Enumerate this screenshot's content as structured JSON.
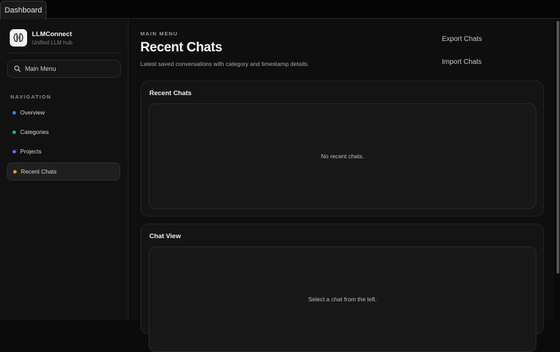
{
  "window": {
    "tab_label": "Dashboard"
  },
  "sidebar": {
    "brand": {
      "name": "LLMConnect",
      "subtitle": "Unified LLM hub"
    },
    "search": {
      "label": "Main Menu",
      "icon": "search-icon"
    },
    "nav_heading": "NAVIGATION",
    "items": [
      {
        "label": "Overview",
        "dot_color": "#3b82f6",
        "active": false
      },
      {
        "label": "Categories",
        "dot_color": "#14b8a6",
        "active": false
      },
      {
        "label": "Projects",
        "dot_color": "#8b5cf6",
        "active": false
      },
      {
        "label": "Recent Chats",
        "dot_color": "#f59e0b",
        "active": true
      }
    ]
  },
  "header": {
    "eyebrow": "MAIN MENU",
    "title": "Recent Chats",
    "subtitle": "Latest saved conversations with category and timestamp details.",
    "actions": {
      "export": "Export Chats",
      "import": "Import Chats"
    }
  },
  "cards": {
    "recent": {
      "title": "Recent Chats",
      "empty": "No recent chats."
    },
    "view": {
      "title": "Chat View",
      "empty": "Select a chat from the left."
    }
  }
}
